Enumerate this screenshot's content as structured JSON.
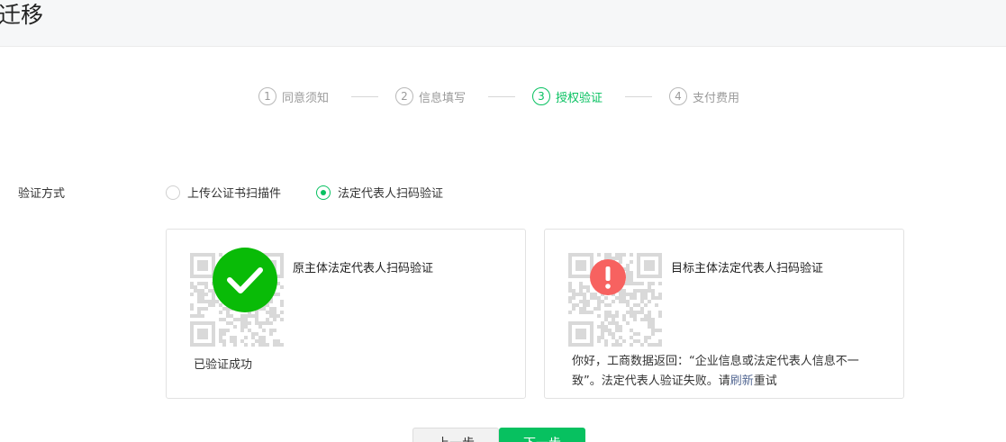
{
  "header": {
    "title": "迁移"
  },
  "steps": [
    {
      "num": "1",
      "label": "同意须知",
      "state": "done"
    },
    {
      "num": "2",
      "label": "信息填写",
      "state": "done"
    },
    {
      "num": "3",
      "label": "授权验证",
      "state": "active"
    },
    {
      "num": "4",
      "label": "支付费用",
      "state": "pending"
    }
  ],
  "verify": {
    "label": "验证方式",
    "options": [
      {
        "label": "上传公证书扫描件",
        "checked": false
      },
      {
        "label": "法定代表人扫码验证",
        "checked": true
      }
    ]
  },
  "cards": {
    "source": {
      "title": "原主体法定代表人扫码验证",
      "status": "已验证成功",
      "state": "success"
    },
    "target": {
      "title": "目标主体法定代表人扫码验证",
      "error_line1": "你好，工商数据返回：“企业信息或法定代表人信息不一",
      "error_line2_prefix": "致”。法定代表人验证失败。请",
      "refresh_link": "刷新",
      "error_line2_suffix": "重试",
      "state": "error"
    }
  },
  "buttons": {
    "prev_label": "上一步",
    "next_label": "下一步"
  },
  "colors": {
    "accent": "#07c160",
    "success": "#09bb07",
    "error": "#f76260",
    "link": "#576b95"
  }
}
